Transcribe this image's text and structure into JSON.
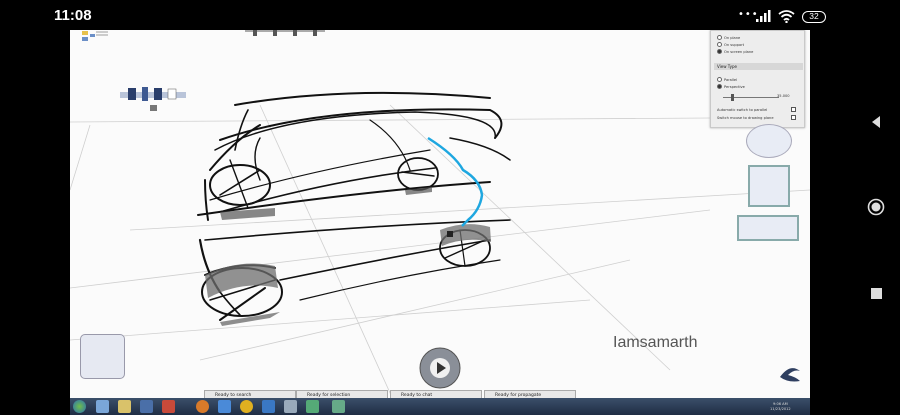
{
  "status_bar": {
    "time": "11:08",
    "dots": "•••",
    "battery": "32"
  },
  "video": {
    "watermark": "Iamsamarth"
  },
  "right_panel": {
    "options": [
      {
        "label": "On plane",
        "selected": false
      },
      {
        "label": "On support",
        "selected": false
      },
      {
        "label": "On screen plane",
        "selected": true
      }
    ],
    "section_title": "View Type",
    "view_options": [
      {
        "label": "Parallel",
        "selected": false
      },
      {
        "label": "Perspective",
        "selected": true
      }
    ],
    "field_value": "35.000",
    "checks": [
      "Automatic switch to parallel",
      "Switch mouse to drawing plane"
    ]
  },
  "task_panes": [
    {
      "label": "Ready to search"
    },
    {
      "label": "Ready for selection"
    },
    {
      "label": "Ready to chat"
    },
    {
      "label": "Ready for propagate"
    }
  ],
  "tray": {
    "time": "9:06 AM",
    "date": "11/23/2012"
  },
  "colors": {
    "accent_curve": "#1ea7e0",
    "taskbar": "#2a3a55"
  }
}
